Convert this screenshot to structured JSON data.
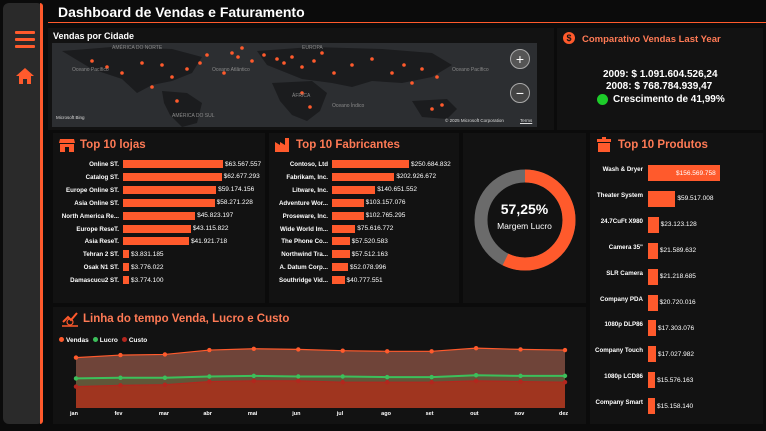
{
  "header": {
    "title": "Dashboard de Vendas e Faturamento"
  },
  "sidebar": {
    "menu_icon": "hamburger-menu-icon",
    "home_icon": "home-icon"
  },
  "colors": {
    "accent": "#ff5a2c",
    "panel": "#121212",
    "background": "#0b0b0b",
    "lucro": "#3cc05b",
    "custo": "#b3261e"
  },
  "map": {
    "title": "Vendas por Cidade",
    "labels": [
      "Oceano Pacífico",
      "Oceano Atlântico",
      "Oceano Índico",
      "Oceano Pacífico",
      "ÁFRICA",
      "AMÉRICA DO SUL",
      "AMÉRICA DO NORTE",
      "EUROPA"
    ],
    "attribution_logo": "Microsoft Bing",
    "attribution": "© 2025 Microsoft Corporation",
    "terms": "Terms",
    "zoom_in": "+",
    "zoom_out": "−"
  },
  "comparativo": {
    "title": "Comparativo Vendas Last Year",
    "icon": "dollar-icon",
    "line2009": "2009: $ 1.091.604.526,24",
    "line2008": "2008: $ 768.784.939,47",
    "growth": "Crescimento de 41,99%"
  },
  "margin": {
    "value": "57,25%",
    "label": "Margem Lucro",
    "fraction": 0.5725
  },
  "chart_data": [
    {
      "type": "bar",
      "title": "Top 10 lojas",
      "categories": [
        "Online ST.",
        "Catalog ST.",
        "Europe Online ST.",
        "Asia Online ST.",
        "North America Re...",
        "Europe ReseT.",
        "Asia ReseT.",
        "Tehran 2 ST.",
        "Osak N1 ST.",
        "Damascucu2 ST."
      ],
      "value_labels": [
        "$63.567.557",
        "$62.677.293",
        "$59.174.156",
        "$58.271.228",
        "$45.823.197",
        "$43.115.822",
        "$41.921.718",
        "$3.831.185",
        "$3.776.022",
        "$3.774.100"
      ],
      "values": [
        63567557,
        62677293,
        59174156,
        58271228,
        45823197,
        43115822,
        41921718,
        3831185,
        3776022,
        3774100
      ]
    },
    {
      "type": "bar",
      "title": "Top 10 Fabricantes",
      "categories": [
        "Contoso, Ltd",
        "Fabrikam, Inc.",
        "Litware, Inc.",
        "Adventure Wor...",
        "Proseware, Inc.",
        "Wide World Im...",
        "The Phone Co...",
        "Northwind Tra...",
        "A. Datum Corp...",
        "Southridge Vid..."
      ],
      "value_labels": [
        "$250.684.832",
        "$202.926.672",
        "$140.651.552",
        "$103.157.076",
        "$102.765.295",
        "$75.616.772",
        "$57.520.583",
        "$57.512.163",
        "$52.078.996",
        "$40.777.551"
      ],
      "values": [
        250684832,
        202926672,
        140651552,
        103157076,
        102765295,
        75616772,
        57520583,
        57512163,
        52078996,
        40777551
      ]
    },
    {
      "type": "bar",
      "title": "Top 10 Produtos",
      "categories": [
        "Wash & Dryer",
        "Theater System",
        "24.7CuFt X980",
        "Camera 35\"",
        "SLR Camera",
        "Company PDA",
        "1080p DLP86",
        "Company Touch",
        "1080p LCD86",
        "Company Smart"
      ],
      "value_labels": [
        "$156.569.758",
        "$59.517.008",
        "$23.123.128",
        "$21.589.632",
        "$21.218.685",
        "$20.720.016",
        "$17.303.076",
        "$17.027.982",
        "$15.576.163",
        "$15.158.140"
      ],
      "values": [
        156569758,
        59517008,
        23123128,
        21589632,
        21218685,
        20720016,
        17303076,
        17027982,
        15576163,
        15158140
      ]
    },
    {
      "type": "area",
      "title": "Linha do tempo Venda, Lucro e Custo",
      "categories": [
        "jan",
        "fev",
        "mar",
        "abr",
        "mai",
        "jun",
        "jul",
        "ago",
        "set",
        "out",
        "nov",
        "dez"
      ],
      "legend_position": "top-left",
      "series": [
        {
          "name": "Vendas",
          "color": "#ff5a2c",
          "values": [
            80,
            84,
            85,
            92,
            94,
            93,
            91,
            90,
            90,
            95,
            93,
            92
          ]
        },
        {
          "name": "Lucro",
          "color": "#3cc05b",
          "values": [
            47,
            48,
            48,
            50,
            51,
            50,
            50,
            49,
            49,
            52,
            51,
            51
          ]
        },
        {
          "name": "Custo",
          "color": "#b3261e",
          "values": [
            34,
            36,
            37,
            42,
            43,
            43,
            41,
            41,
            41,
            43,
            42,
            41
          ]
        }
      ]
    }
  ]
}
